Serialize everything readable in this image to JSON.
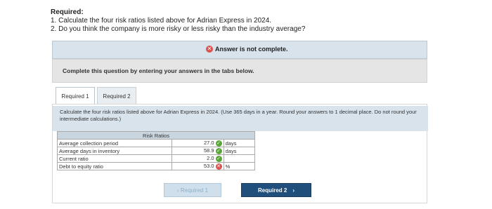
{
  "required": {
    "title": "Required:",
    "q1": "1. Calculate the four risk ratios listed above for Adrian Express in 2024.",
    "q2": "2. Do you think the company is more risky or less risky than the industry average?"
  },
  "banner": {
    "text": "Answer is not complete."
  },
  "instructions": {
    "text": "Complete this question by entering your answers in the tabs below."
  },
  "tabs": [
    {
      "label": "Required 1"
    },
    {
      "label": "Required 2"
    }
  ],
  "panel": {
    "instruction": "Calculate the four risk ratios listed above for Adrian Express in 2024. (Use 365 days in a year. Round your answers to 1 decimal place. Do not round your intermediate calculations.)",
    "table_header": "Risk Ratios",
    "rows": [
      {
        "label": "Average collection period",
        "value": "27.0",
        "status": "correct",
        "unit": "days"
      },
      {
        "label": "Average days in inventory",
        "value": "58.9",
        "status": "correct",
        "unit": "days"
      },
      {
        "label": "Current ratio",
        "value": "2.0",
        "status": "correct",
        "unit": ""
      },
      {
        "label": "Debt to equity ratio",
        "value": "53.0",
        "status": "incorrect",
        "unit": "%"
      }
    ]
  },
  "nav": {
    "prev_label": "Required 1",
    "next_label": "Required 2",
    "prev_icon": "chevron-left-icon",
    "next_icon": "chevron-right-icon"
  },
  "colors": {
    "correct": "#5aa537",
    "incorrect": "#d9534f",
    "primary_button": "#1f4f7a"
  }
}
